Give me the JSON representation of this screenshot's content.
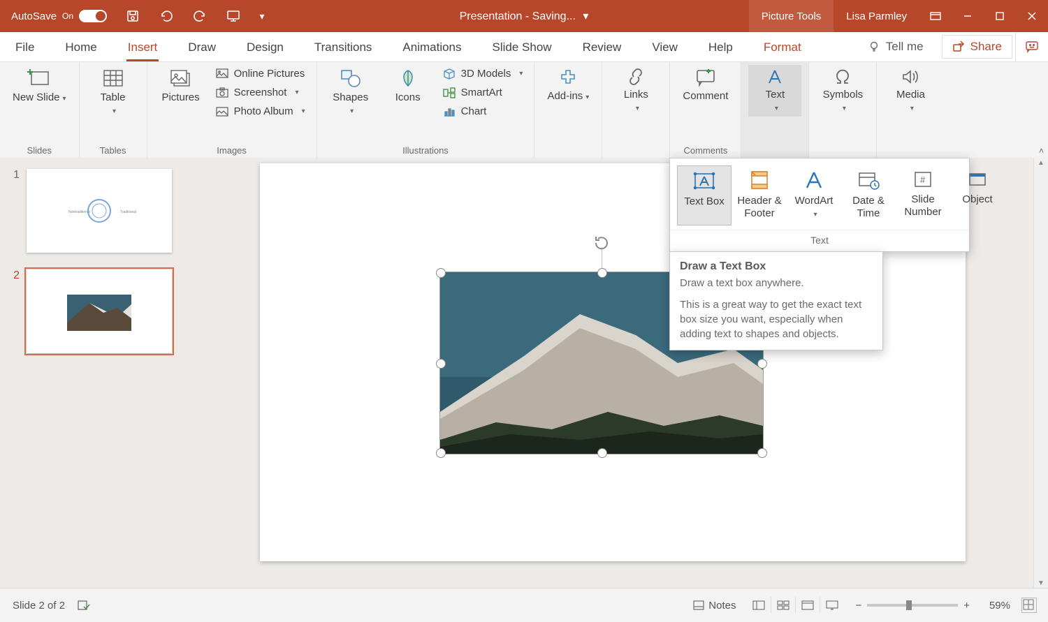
{
  "titlebar": {
    "autosave_label": "AutoSave",
    "autosave_state": "On",
    "doc_title": "Presentation  -  Saving...",
    "picture_tools": "Picture Tools",
    "user": "Lisa Parmley"
  },
  "tabs": {
    "file": "File",
    "home": "Home",
    "insert": "Insert",
    "draw": "Draw",
    "design": "Design",
    "transitions": "Transitions",
    "animations": "Animations",
    "slideshow": "Slide Show",
    "review": "Review",
    "view": "View",
    "help": "Help",
    "format": "Format",
    "tell_me": "Tell me",
    "share": "Share"
  },
  "ribbon": {
    "slides_group": "Slides",
    "new_slide": "New Slide",
    "tables_group": "Tables",
    "table": "Table",
    "images_group": "Images",
    "pictures": "Pictures",
    "online_pictures": "Online Pictures",
    "screenshot": "Screenshot",
    "photo_album": "Photo Album",
    "illustrations_group": "Illustrations",
    "shapes": "Shapes",
    "icons": "Icons",
    "models_3d": "3D Models",
    "smartart": "SmartArt",
    "chart": "Chart",
    "addins": "Add-ins",
    "links": "Links",
    "comments_group": "Comments",
    "comment": "Comment",
    "text": "Text",
    "symbols": "Symbols",
    "media": "Media"
  },
  "text_gallery": {
    "group_label": "Text",
    "text_box": "Text Box",
    "header_footer": "Header & Footer",
    "wordart": "WordArt",
    "date_time": "Date & Time",
    "slide_number": "Slide Number",
    "object": "Object"
  },
  "tooltip": {
    "title": "Draw a Text Box",
    "line1": "Draw a text box anywhere.",
    "line2": "This is a great way to get the exact text box size you want, especially when adding text to shapes and objects."
  },
  "thumbs": {
    "n1": "1",
    "n2": "2"
  },
  "statusbar": {
    "slide_info": "Slide 2 of 2",
    "notes": "Notes",
    "zoom_pct": "59%"
  }
}
